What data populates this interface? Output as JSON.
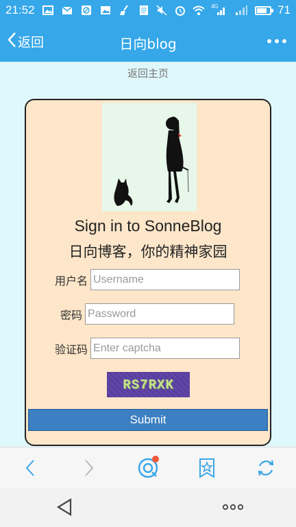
{
  "status_bar": {
    "time": "21:52",
    "network": "4G",
    "battery": "71",
    "battery_fraction": 0.71
  },
  "app_bar": {
    "back_label": "返回",
    "title": "日向blog"
  },
  "home_link": "返回主页",
  "login": {
    "title_en": "Sign in to SonneBlog",
    "title_cn": "日向博客，你的精神家园",
    "username_label": "用户名",
    "username_placeholder": "Username",
    "password_label": "密码",
    "password_placeholder": "Password",
    "captcha_label": "验证码",
    "captcha_placeholder": "Enter captcha",
    "captcha_text": "RS7RXK",
    "submit_label": "Submit"
  },
  "icons": {
    "back": "chevron-left-icon",
    "more": "more-horizontal-icon",
    "browser_back": "arrow-left-icon",
    "browser_forward": "arrow-right-icon",
    "browser_home": "browser-logo-icon",
    "bookmark": "bookmark-star-icon",
    "refresh": "refresh-icon",
    "nav_back": "triangle-back-icon",
    "nav_menu": "dots-menu-icon"
  },
  "colors": {
    "header": "#36a7e9",
    "page_background": "#dff8fb",
    "card_background": "#fde6c9",
    "submit": "#3c7fc2",
    "captcha_background": "#5a3fa0",
    "notification": "#f25a3b"
  }
}
